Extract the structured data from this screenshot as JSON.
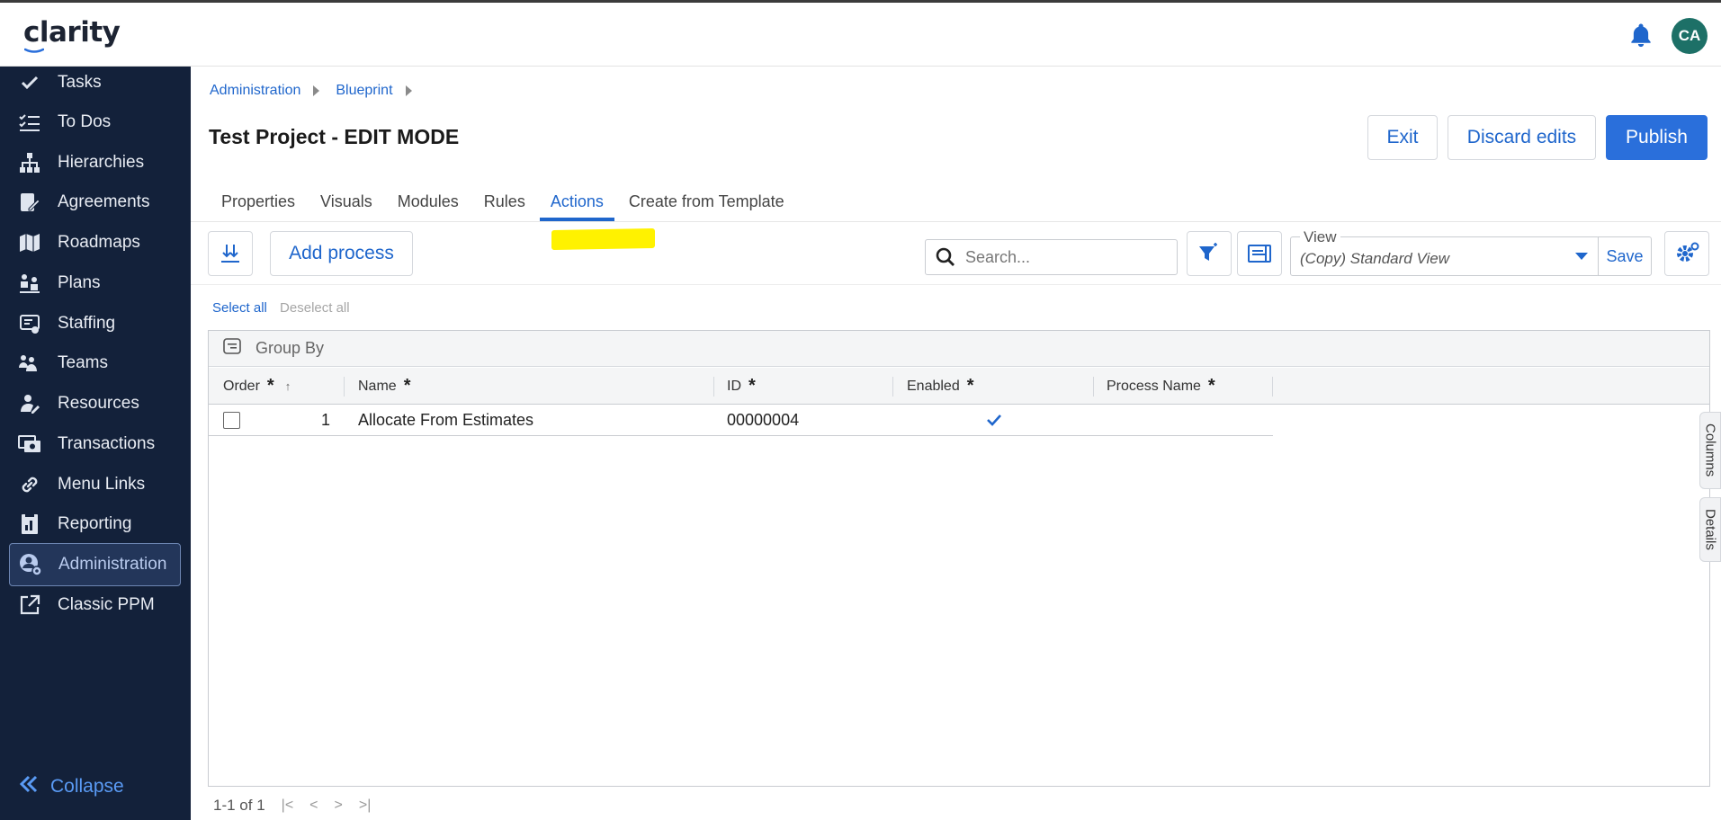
{
  "app": {
    "logo": "clarity",
    "avatar_initials": "CA"
  },
  "sidebar": {
    "items": [
      {
        "label": "Tasks",
        "icon": "check-icon"
      },
      {
        "label": "To Dos",
        "icon": "todo-list-icon"
      },
      {
        "label": "Hierarchies",
        "icon": "hierarchy-icon"
      },
      {
        "label": "Agreements",
        "icon": "agreements-icon"
      },
      {
        "label": "Roadmaps",
        "icon": "map-icon"
      },
      {
        "label": "Plans",
        "icon": "plans-icon"
      },
      {
        "label": "Staffing",
        "icon": "staffing-icon"
      },
      {
        "label": "Teams",
        "icon": "teams-icon"
      },
      {
        "label": "Resources",
        "icon": "resources-icon"
      },
      {
        "label": "Transactions",
        "icon": "transactions-icon"
      },
      {
        "label": "Menu Links",
        "icon": "link-icon"
      },
      {
        "label": "Reporting",
        "icon": "reporting-icon"
      },
      {
        "label": "Administration",
        "icon": "admin-gear-icon"
      },
      {
        "label": "Classic PPM",
        "icon": "external-link-icon"
      }
    ],
    "active": "Administration",
    "collapse_label": "Collapse"
  },
  "breadcrumb": [
    "Administration",
    "Blueprint"
  ],
  "page": {
    "title": "Test Project - EDIT MODE"
  },
  "header_buttons": {
    "exit": "Exit",
    "discard": "Discard edits",
    "publish": "Publish"
  },
  "tabs": [
    "Properties",
    "Visuals",
    "Modules",
    "Rules",
    "Actions",
    "Create from Template"
  ],
  "active_tab": "Actions",
  "toolbar": {
    "add_process": "Add process",
    "search_placeholder": "Search...",
    "view_label": "View",
    "view_value": "(Copy) Standard View",
    "save_label": "Save"
  },
  "selection": {
    "select_all": "Select all",
    "deselect_all": "Deselect all"
  },
  "grid": {
    "group_by": "Group By",
    "columns": [
      "Order",
      "Name",
      "ID",
      "Enabled",
      "Process Name"
    ],
    "rows": [
      {
        "order": "1",
        "name": "Allocate From Estimates",
        "id": "00000004",
        "enabled": true,
        "process_name": ""
      }
    ]
  },
  "side_tabs": {
    "columns": "Columns",
    "details": "Details"
  },
  "pager": {
    "summary": "1-1 of 1"
  },
  "colors": {
    "sidebar_bg": "#13213a",
    "accent": "#1f66cc",
    "primary_button": "#2a6fdb",
    "highlight": "#fff200",
    "avatar": "#1d7067"
  }
}
